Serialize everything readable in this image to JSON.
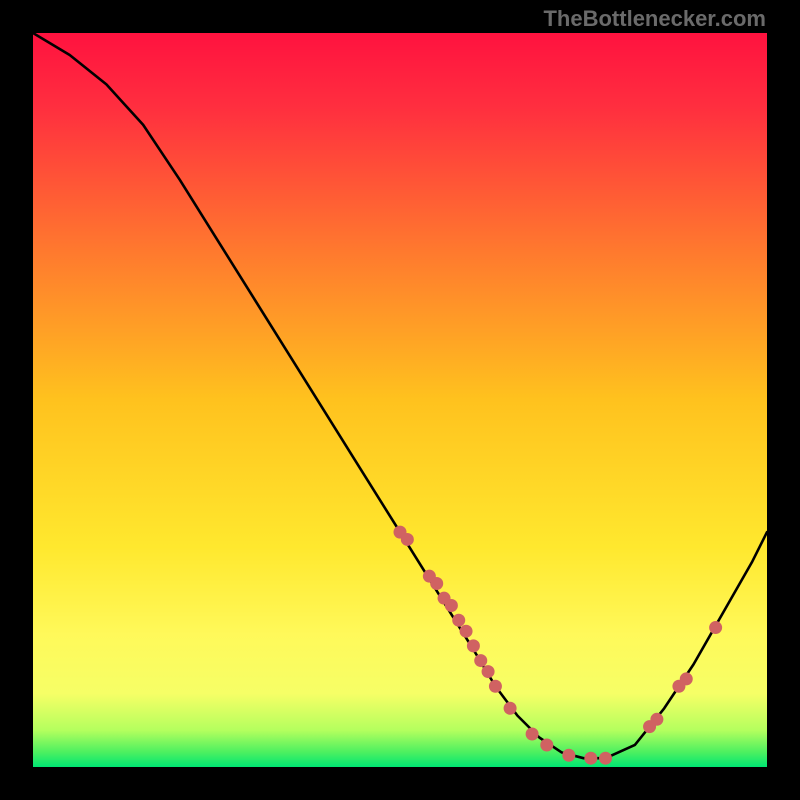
{
  "watermark": "TheBottlenecker.com",
  "colors": {
    "black": "#000000",
    "curve_stroke": "#000000",
    "marker_fill": "#d06262",
    "gradient_top": "#ff1a4a",
    "gradient_mid1": "#ff5a3a",
    "gradient_mid2": "#ffd21e",
    "gradient_mid3": "#fff966",
    "gradient_bottom": "#00e673"
  },
  "chart_data": {
    "type": "line",
    "title": "",
    "xlabel": "",
    "ylabel": "",
    "xlim": [
      0,
      100
    ],
    "ylim": [
      0,
      100
    ],
    "curve": {
      "x": [
        0,
        5,
        10,
        15,
        20,
        25,
        30,
        35,
        40,
        45,
        50,
        55,
        60,
        63,
        66,
        69,
        72,
        75,
        78,
        82,
        86,
        90,
        94,
        98,
        100
      ],
      "y": [
        100,
        97,
        93,
        87.5,
        80,
        72,
        64,
        56,
        48,
        40,
        32,
        24,
        16,
        11,
        7,
        4,
        2,
        1.2,
        1.2,
        3,
        8,
        14,
        21,
        28,
        32
      ]
    },
    "markers": {
      "x": [
        50,
        51,
        54,
        55,
        56,
        57,
        58,
        59,
        60,
        61,
        62,
        63,
        65,
        68,
        70,
        73,
        76,
        78,
        84,
        85,
        88,
        89,
        93
      ],
      "y": [
        32,
        31,
        26,
        25,
        23,
        22,
        20,
        18.5,
        16.5,
        14.5,
        13,
        11,
        8,
        4.5,
        3,
        1.6,
        1.2,
        1.2,
        5.5,
        6.5,
        11,
        12,
        19
      ]
    }
  }
}
